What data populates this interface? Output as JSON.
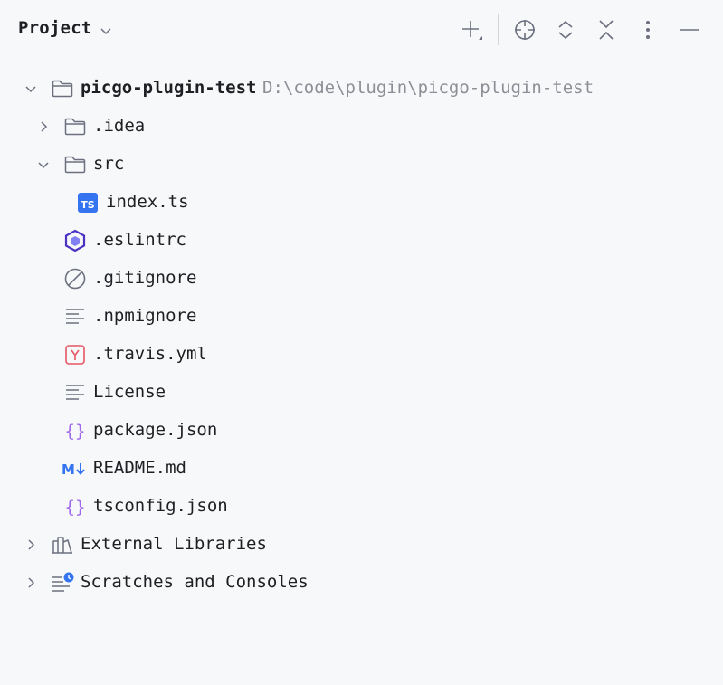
{
  "header": {
    "title": "Project"
  },
  "tree": {
    "root": {
      "name": "picgo-plugin-test",
      "path": "D:\\code\\plugin\\picgo-plugin-test"
    },
    "items": [
      {
        "name": ".idea"
      },
      {
        "name": "src"
      },
      {
        "name": "index.ts"
      },
      {
        "name": ".eslintrc"
      },
      {
        "name": ".gitignore"
      },
      {
        "name": ".npmignore"
      },
      {
        "name": ".travis.yml"
      },
      {
        "name": "License"
      },
      {
        "name": "package.json"
      },
      {
        "name": "README.md"
      },
      {
        "name": "tsconfig.json"
      }
    ],
    "external_libraries": "External Libraries",
    "scratches": "Scratches and Consoles"
  },
  "colors": {
    "selection": "#d4e2ff",
    "background": "#f7f8fa",
    "ts_icon": "#3574f0",
    "eslint_icon": "#4b32c3",
    "yaml_icon": "#e55765",
    "json_icon": "#9f68e8",
    "markdown_icon": "#3574f0"
  }
}
